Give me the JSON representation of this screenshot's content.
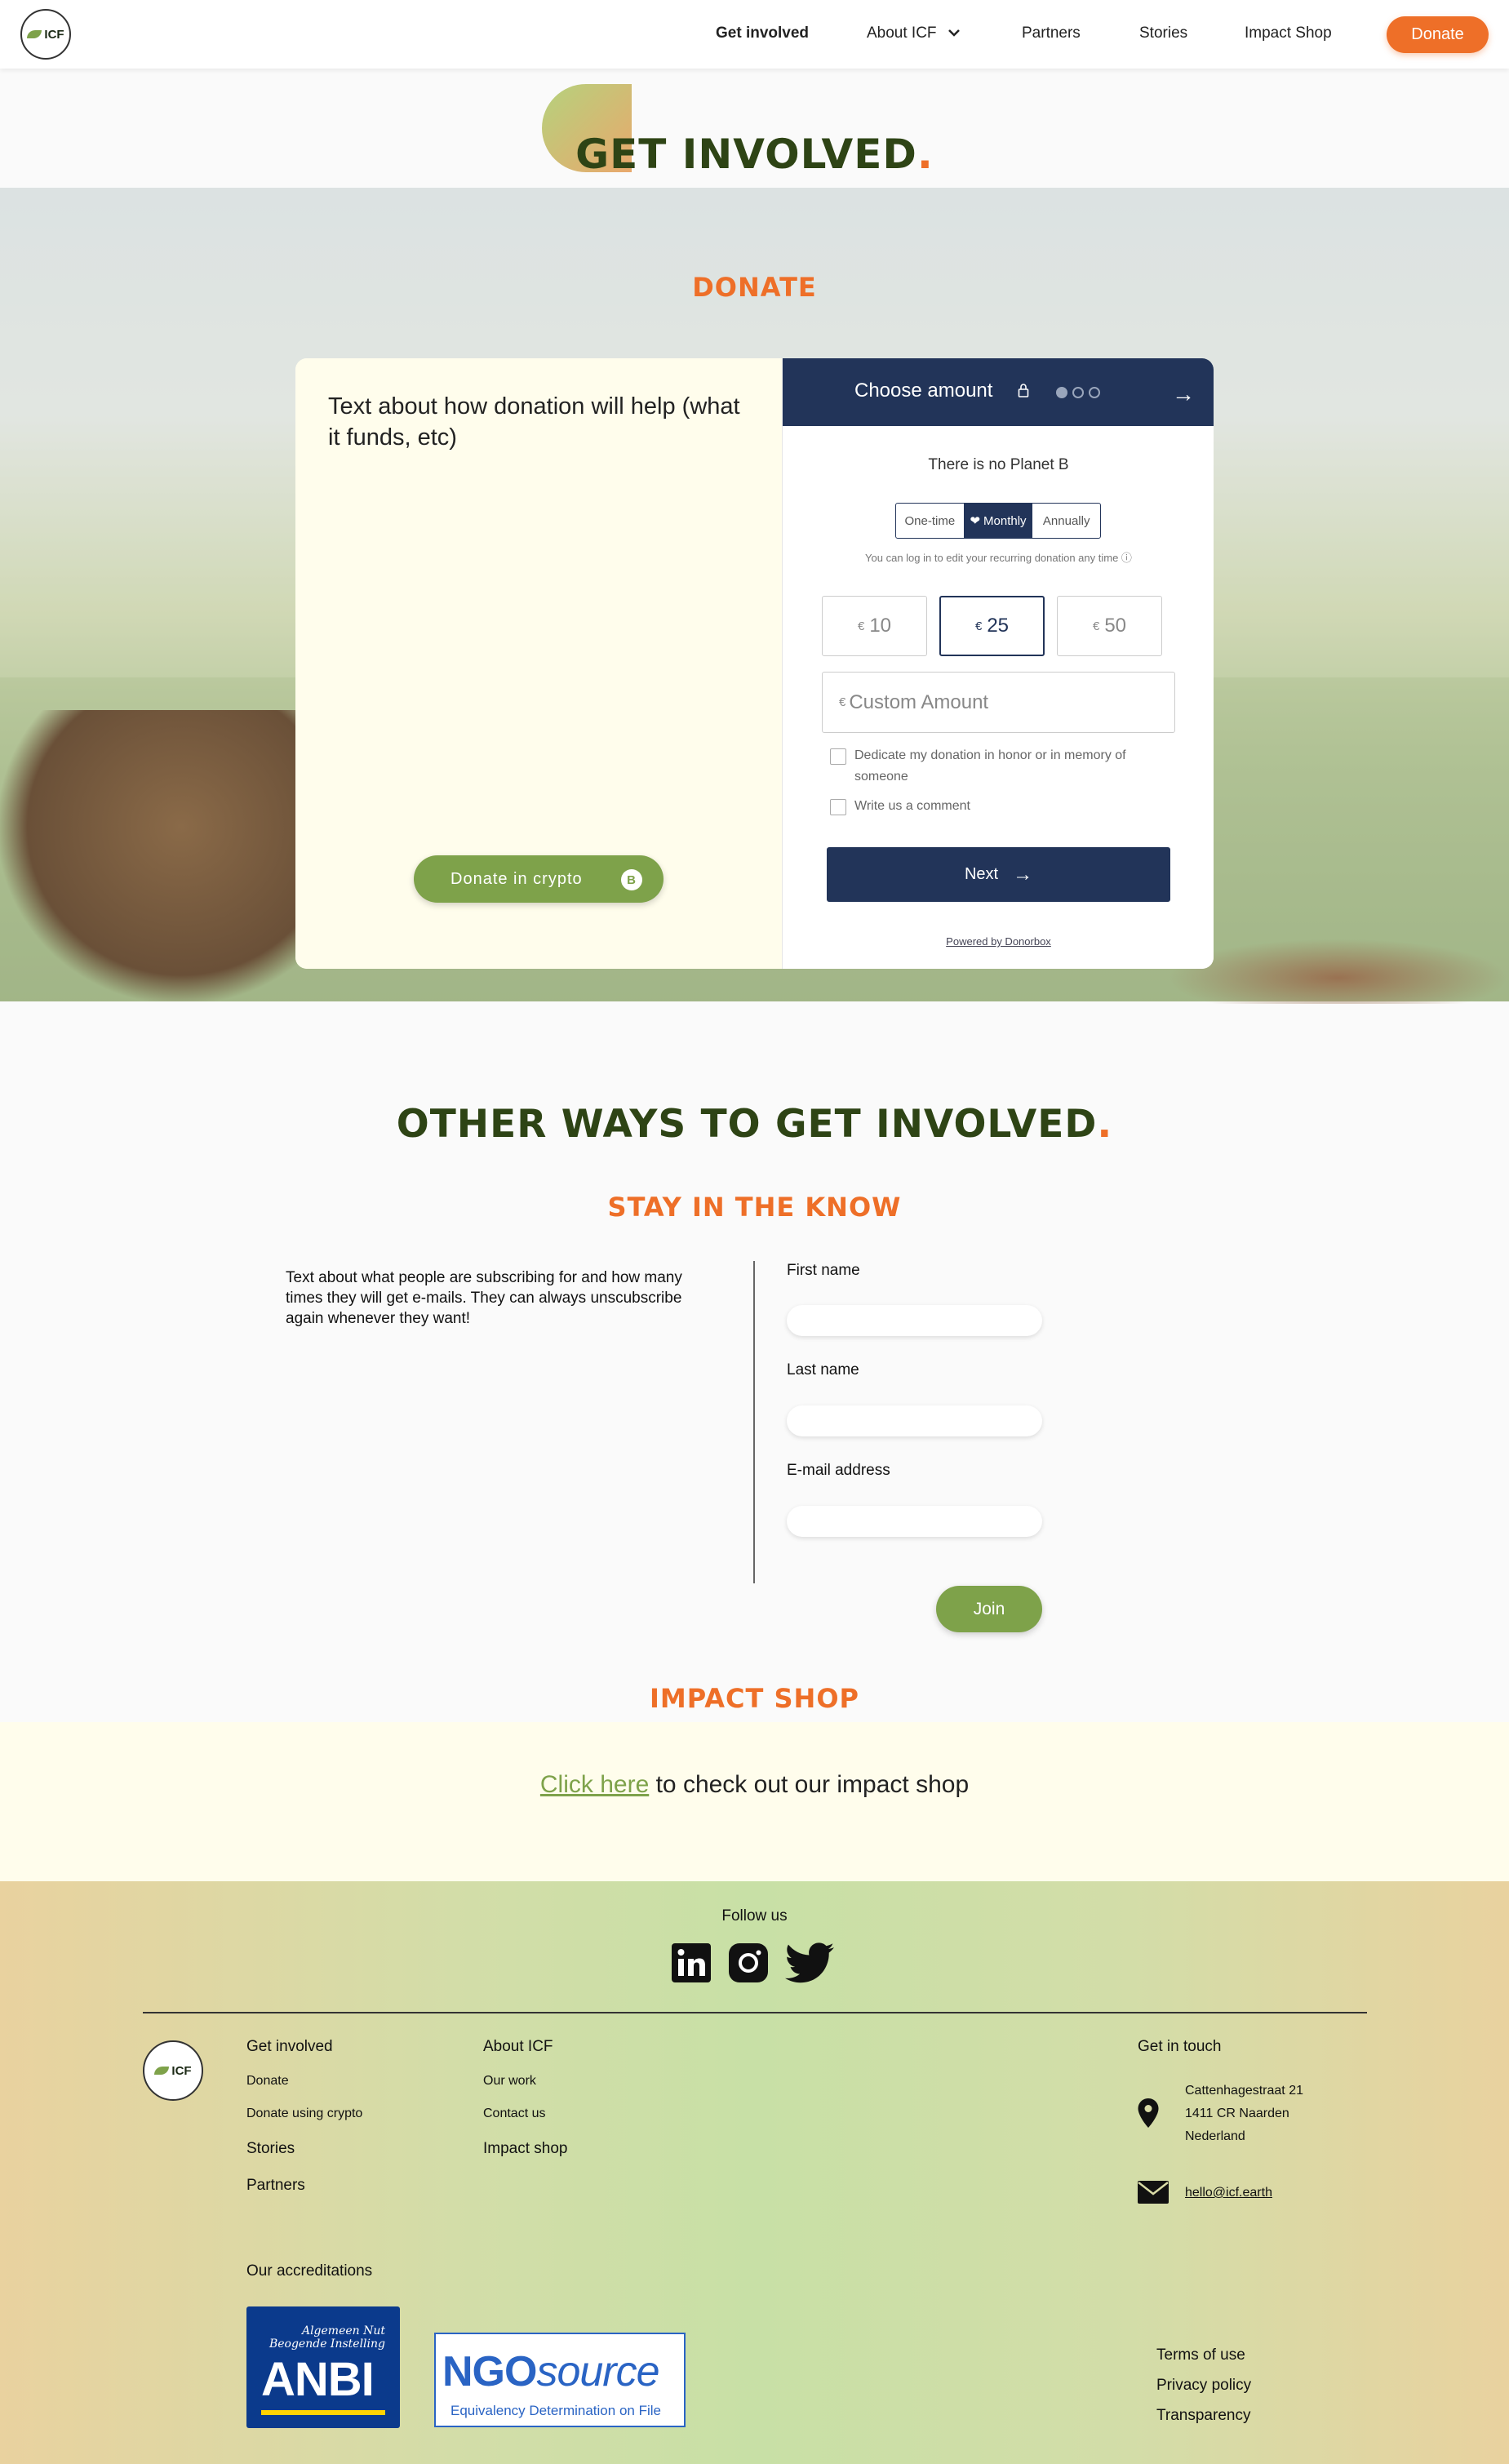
{
  "nav": {
    "logo_text": "ICF",
    "items": [
      "Get involved",
      "About ICF",
      "Partners",
      "Stories",
      "Impact Shop"
    ],
    "donate_label": "Donate"
  },
  "hero": {
    "title": "GET INVOLVED",
    "dot": "."
  },
  "donate": {
    "heading": "DONATE",
    "left_text": "Text about how donation will help (what it funds, etc)",
    "crypto_label": "Donate in crypto",
    "crypto_icon": "B",
    "widget": {
      "header_title": "Choose amount",
      "campaign_title": "There is no Planet B",
      "frequencies": [
        "One-time",
        "Monthly",
        "Annually"
      ],
      "selected_frequency": "Monthly",
      "monthly_prefix": "❤",
      "note": "You can log in to edit your recurring donation any time ⓘ",
      "currency": "€",
      "amounts": [
        "10",
        "25",
        "50"
      ],
      "selected_amount": "25",
      "custom_placeholder": "Custom Amount",
      "checkbox_dedicate": "Dedicate my donation in honor or in memory of someone",
      "checkbox_comment": "Write us a comment",
      "next_label": "Next",
      "powered_by": "Powered by Donorbox"
    }
  },
  "other": {
    "title": "OTHER WAYS TO GET INVOLVED",
    "stay_heading": "STAY IN THE KNOW",
    "stay_text": "Text about what people are subscribing for and how many times they will get e-mails. They can always unscubscribe again whenever they want!",
    "first_name_label": "First name",
    "last_name_label": "Last name",
    "email_label": "E-mail address",
    "join_label": "Join"
  },
  "shop": {
    "heading": "IMPACT SHOP",
    "link_text": "Click here",
    "rest_text": " to check out our impact shop"
  },
  "footer": {
    "follow_label": "Follow us",
    "social_icons": [
      "linkedin-icon",
      "instagram-icon",
      "twitter-icon"
    ],
    "col1": {
      "title": "Get involved",
      "links": [
        "Donate",
        "Donate using crypto"
      ],
      "extra": [
        "Stories",
        "Partners"
      ]
    },
    "col2": {
      "title": "About ICF",
      "links": [
        "Our work",
        "Contact us"
      ],
      "extra": [
        "Impact shop"
      ]
    },
    "contact": {
      "title": "Get in touch",
      "address_lines": [
        "Cattenhagestraat 21",
        "1411 CR Naarden",
        "Nederland"
      ],
      "email": "hello@icf.earth"
    },
    "accreditations_title": "Our accreditations",
    "anbi_line1": "Algemeen Nut",
    "anbi_line2": "Beogende Instelling",
    "anbi_big": "ANBI",
    "ngo_bold": "NGO",
    "ngo_italic": "source",
    "ngo_sub": "Equivalency Determination on File",
    "legal": [
      "Terms of use",
      "Privacy policy",
      "Transparency"
    ]
  },
  "colors": {
    "accent_orange": "#ee6f28",
    "green": "#7ea24a",
    "navy": "#223459",
    "dark_green": "#2e4415"
  }
}
